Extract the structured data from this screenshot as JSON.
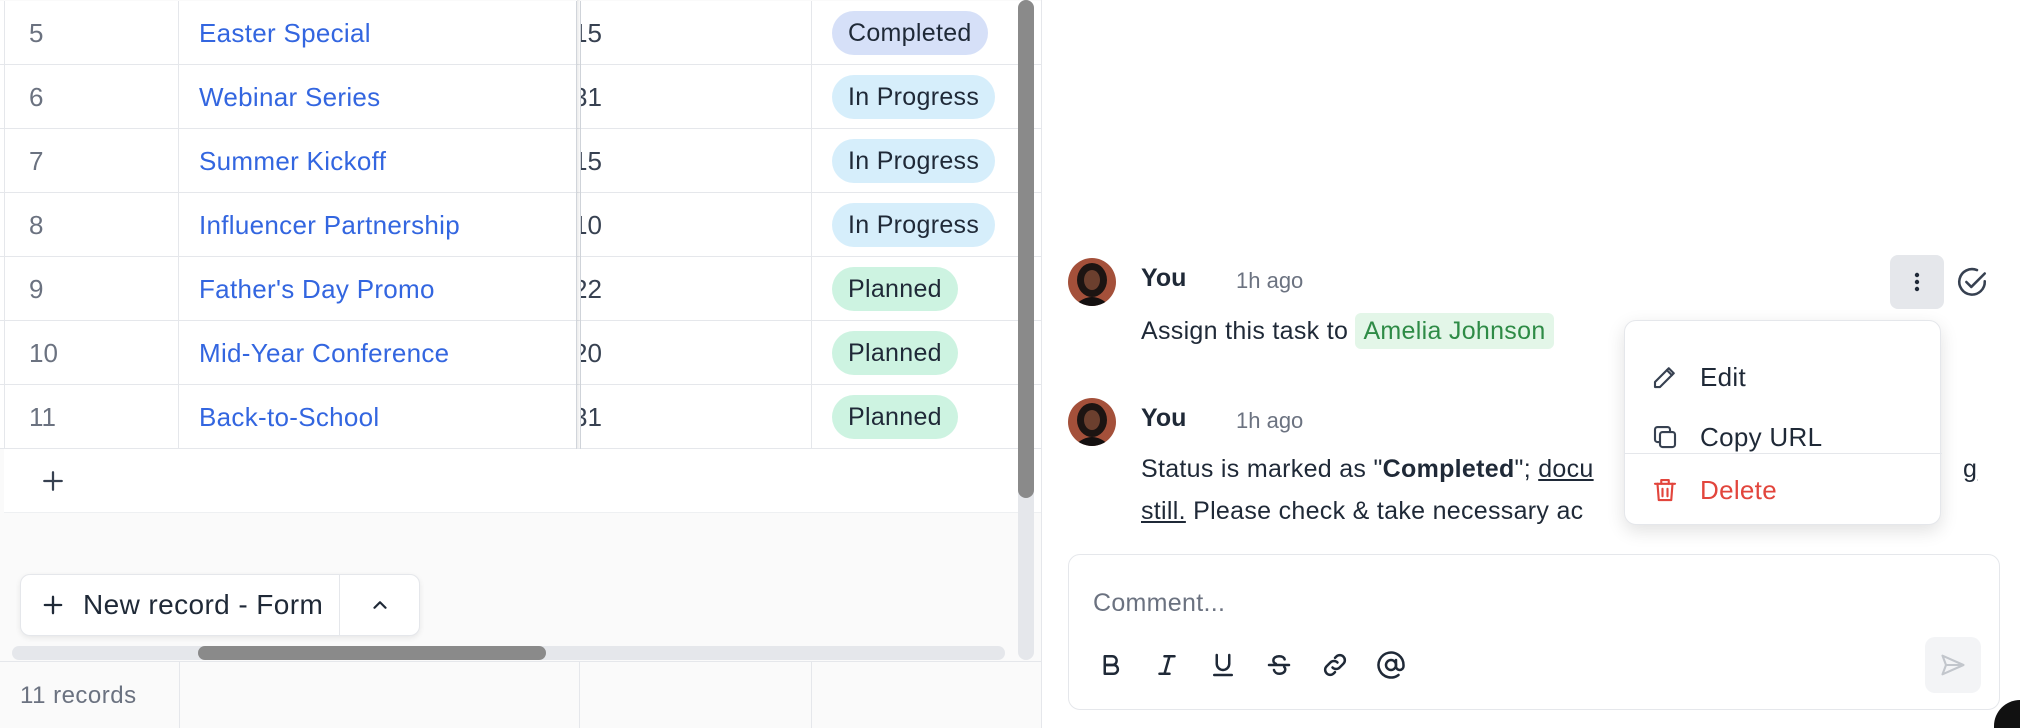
{
  "grid": {
    "rows": [
      {
        "num": "5",
        "name": "Easter Special",
        "date_fragment": "15",
        "status": "Completed",
        "status_kind": "completed"
      },
      {
        "num": "6",
        "name": "Webinar Series",
        "date_fragment": "31",
        "status": "In Progress",
        "status_kind": "progress"
      },
      {
        "num": "7",
        "name": "Summer Kickoff",
        "date_fragment": "15",
        "status": "In Progress",
        "status_kind": "progress"
      },
      {
        "num": "8",
        "name": "Influencer Partnership",
        "date_fragment": "10",
        "status": "In Progress",
        "status_kind": "progress"
      },
      {
        "num": "9",
        "name": "Father's Day Promo",
        "date_fragment": "22",
        "status": "Planned",
        "status_kind": "planned"
      },
      {
        "num": "10",
        "name": "Mid-Year Conference",
        "date_fragment": "20",
        "status": "Planned",
        "status_kind": "planned"
      },
      {
        "num": "11",
        "name": "Back-to-School",
        "date_fragment": "31",
        "status": "Planned",
        "status_kind": "planned"
      }
    ],
    "add_row_icon": "plus-icon",
    "new_record_label": "New record - Form",
    "record_count": "11 records"
  },
  "comments": [
    {
      "author": "You",
      "time": "1h ago",
      "text_prefix": "Assign this task to ",
      "mention": "Amelia Johnson"
    },
    {
      "author": "You",
      "time": "1h ago",
      "text_start": "Status is marked as \"",
      "text_bold": "Completed",
      "text_mid": "\"; ",
      "text_link1": "docu",
      "text_hidden_gap": "",
      "text_link2_end": "g",
      "text_line2_link": "still.",
      "text_end": " Please check & take necessary ac"
    }
  ],
  "context_menu": {
    "items": [
      {
        "label": "Edit",
        "icon": "pencil-icon"
      },
      {
        "label": "Copy URL",
        "icon": "copy-icon"
      },
      {
        "label": "Delete",
        "icon": "trash-icon"
      }
    ]
  },
  "composer": {
    "placeholder": "Comment...",
    "toolbar": [
      "bold-icon",
      "italic-icon",
      "underline-icon",
      "strikethrough-icon",
      "link-icon",
      "at-icon"
    ],
    "send_icon": "send-icon"
  },
  "colors": {
    "link_blue": "#3366e0",
    "completed_bg": "#d6e0f8",
    "in_progress_bg": "#d6eefb",
    "planned_bg": "#cdf3e1",
    "mention_bg": "#e3f6e8",
    "mention_text": "#2e8b46",
    "danger": "#e2453c"
  }
}
